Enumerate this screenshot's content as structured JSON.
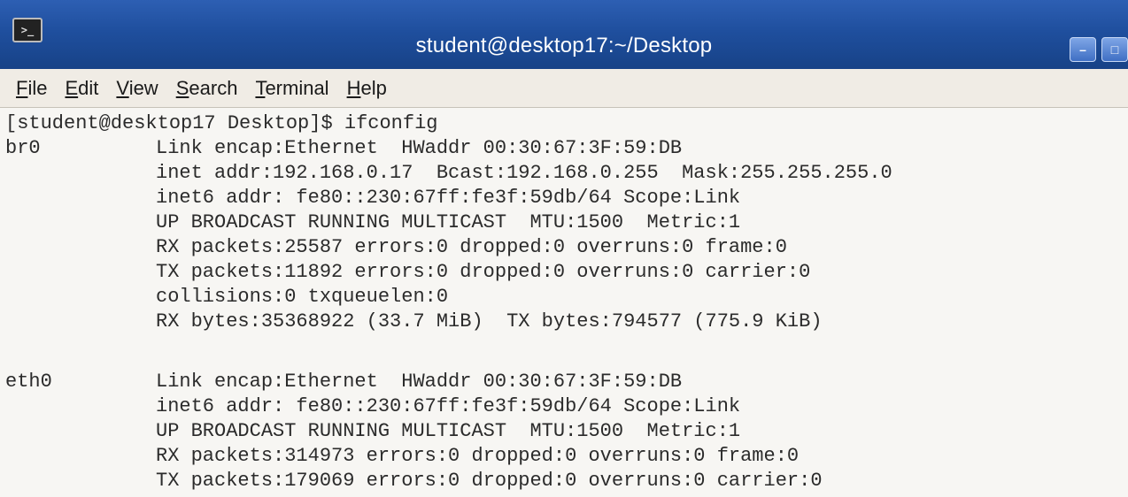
{
  "window": {
    "title": "student@desktop17:~/Desktop"
  },
  "menu": {
    "items": [
      {
        "label": "File"
      },
      {
        "label": "Edit"
      },
      {
        "label": "View"
      },
      {
        "label": "Search"
      },
      {
        "label": "Terminal"
      },
      {
        "label": "Help"
      }
    ]
  },
  "terminal": {
    "prompt": "[student@desktop17 Desktop]$ ifconfig",
    "interfaces": [
      {
        "name": "br0",
        "lines": [
          "Link encap:Ethernet  HWaddr 00:30:67:3F:59:DB",
          "inet addr:192.168.0.17  Bcast:192.168.0.255  Mask:255.255.255.0",
          "inet6 addr: fe80::230:67ff:fe3f:59db/64 Scope:Link",
          "UP BROADCAST RUNNING MULTICAST  MTU:1500  Metric:1",
          "RX packets:25587 errors:0 dropped:0 overruns:0 frame:0",
          "TX packets:11892 errors:0 dropped:0 overruns:0 carrier:0",
          "collisions:0 txqueuelen:0",
          "RX bytes:35368922 (33.7 MiB)  TX bytes:794577 (775.9 KiB)"
        ]
      },
      {
        "name": "eth0",
        "lines": [
          "Link encap:Ethernet  HWaddr 00:30:67:3F:59:DB",
          "inet6 addr: fe80::230:67ff:fe3f:59db/64 Scope:Link",
          "UP BROADCAST RUNNING MULTICAST  MTU:1500  Metric:1",
          "RX packets:314973 errors:0 dropped:0 overruns:0 frame:0",
          "TX packets:179069 errors:0 dropped:0 overruns:0 carrier:0"
        ]
      }
    ]
  }
}
